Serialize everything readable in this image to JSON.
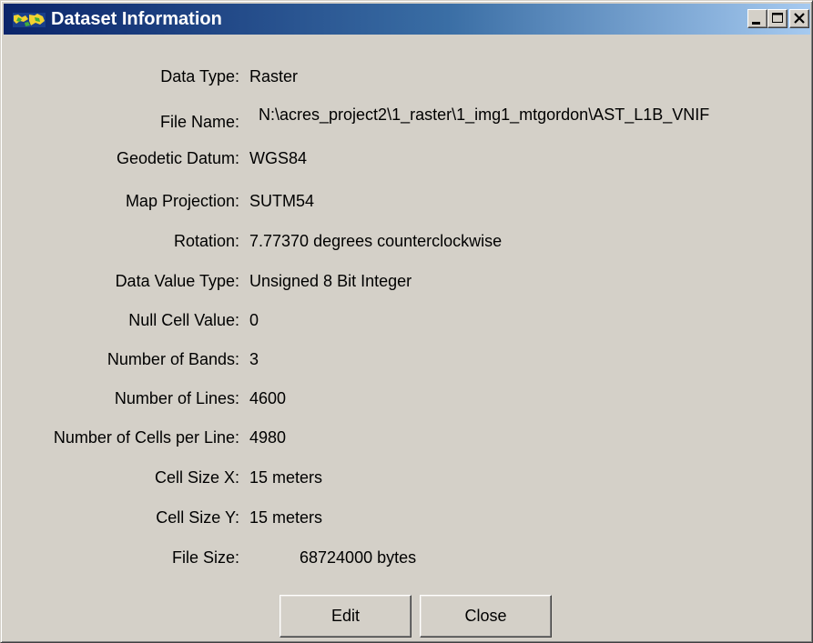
{
  "window": {
    "title": "Dataset Information"
  },
  "fields": [
    {
      "label": "Data Type:",
      "value": "Raster"
    },
    {
      "label": "File Name:",
      "value": "N:\\acres_project2\\1_raster\\1_img1_mtgordon\\AST_L1B_VNIF"
    },
    {
      "label": "Geodetic Datum:",
      "value": "WGS84"
    },
    {
      "label": "Map Projection:",
      "value": "SUTM54"
    },
    {
      "label": "Rotation:",
      "value": "7.77370 degrees counterclockwise"
    },
    {
      "label": "Data Value Type:",
      "value": "Unsigned 8 Bit Integer"
    },
    {
      "label": "Null Cell Value:",
      "value": "0"
    },
    {
      "label": "Number of Bands:",
      "value": "3"
    },
    {
      "label": "Number of Lines:",
      "value": "4600"
    },
    {
      "label": "Number of Cells per Line:",
      "value": "4980"
    },
    {
      "label": "Cell Size X:",
      "value": "15 meters"
    },
    {
      "label": "Cell Size Y:",
      "value": "15 meters"
    },
    {
      "label": "File Size:",
      "value": "68724000 bytes"
    }
  ],
  "buttons": {
    "edit": "Edit",
    "close": "Close"
  },
  "icons": {
    "app": "map-raster-icon",
    "minimize": "minimize-icon",
    "maximize": "maximize-icon",
    "close": "close-icon"
  },
  "colors": {
    "titlebar_start": "#0a246a",
    "titlebar_end": "#a6caf0",
    "face": "#d4d0c8"
  }
}
